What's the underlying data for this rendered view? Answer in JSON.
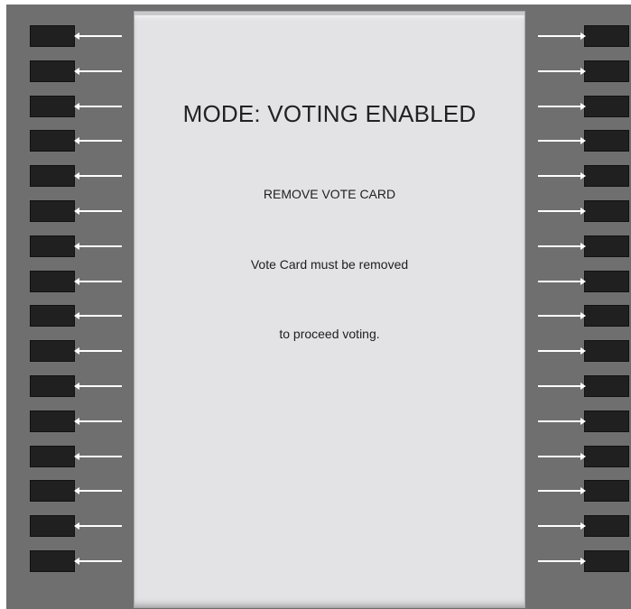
{
  "screen": {
    "mode_title": "MODE: VOTING ENABLED",
    "instruction": "REMOVE VOTE CARD",
    "message_line_1": "Vote Card must be removed",
    "message_line_2": "to proceed voting."
  },
  "side_buttons": {
    "left_count": 16,
    "right_count": 16
  },
  "colors": {
    "frame": "#6f6f70",
    "panel": "#e3e3e6",
    "button": "#202020",
    "arrow": "#ffffff"
  }
}
